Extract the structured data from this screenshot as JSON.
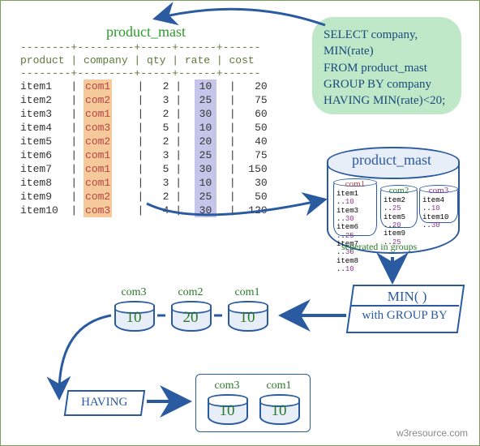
{
  "table_title": "product_mast",
  "headers": {
    "product": "product",
    "company": "company",
    "qty": "qty",
    "rate": "rate",
    "cost": "cost"
  },
  "rows": [
    {
      "product": "item1",
      "company": "com1",
      "qty": "2",
      "rate": "10",
      "cost": "20"
    },
    {
      "product": "item2",
      "company": "com2",
      "qty": "3",
      "rate": "25",
      "cost": "75"
    },
    {
      "product": "item3",
      "company": "com1",
      "qty": "2",
      "rate": "30",
      "cost": "60"
    },
    {
      "product": "item4",
      "company": "com3",
      "qty": "5",
      "rate": "10",
      "cost": "50"
    },
    {
      "product": "item5",
      "company": "com2",
      "qty": "2",
      "rate": "20",
      "cost": "40"
    },
    {
      "product": "item6",
      "company": "com1",
      "qty": "3",
      "rate": "25",
      "cost": "75"
    },
    {
      "product": "item7",
      "company": "com1",
      "qty": "5",
      "rate": "30",
      "cost": "150"
    },
    {
      "product": "item8",
      "company": "com1",
      "qty": "3",
      "rate": "10",
      "cost": "30"
    },
    {
      "product": "item9",
      "company": "com2",
      "qty": "2",
      "rate": "25",
      "cost": "50"
    },
    {
      "product": "item10",
      "company": "com3",
      "qty": "4",
      "rate": "30",
      "cost": "120"
    }
  ],
  "sql": {
    "l1": "SELECT company,",
    "l2": "MIN(rate)",
    "l3": "FROM product_mast",
    "l4": "GROUP BY company",
    "l5": "HAVING MIN(rate)<20;"
  },
  "big_cyl_title": "product_mast",
  "groups": {
    "com1": {
      "name": "com1",
      "items": [
        [
          "item1",
          "10"
        ],
        [
          "item3",
          "30"
        ],
        [
          "item6",
          "25"
        ],
        [
          "item7",
          "30"
        ],
        [
          "item8",
          "10"
        ]
      ]
    },
    "com2": {
      "name": "com2",
      "items": [
        [
          "item2",
          "25"
        ],
        [
          "item5",
          "20"
        ],
        [
          "item9",
          "25"
        ]
      ]
    },
    "com3": {
      "name": "com3",
      "items": [
        [
          "item4",
          "10"
        ],
        [
          "item10",
          "30"
        ]
      ]
    }
  },
  "sep_text": "seperated in groups",
  "min_box": {
    "t1": "MIN( )",
    "t2": "with GROUP BY"
  },
  "mins": {
    "com1": {
      "lbl": "com1",
      "val": "10"
    },
    "com2": {
      "lbl": "com2",
      "val": "20"
    },
    "com3": {
      "lbl": "com3",
      "val": "10"
    }
  },
  "having": "HAVING",
  "final": {
    "com3": {
      "lbl": "com3",
      "val": "10"
    },
    "com1": {
      "lbl": "com1",
      "val": "10"
    }
  },
  "credit": "w3resource.com",
  "chart_data": {
    "type": "table",
    "title": "product_mast",
    "columns": [
      "product",
      "company",
      "qty",
      "rate",
      "cost"
    ],
    "rows": [
      [
        "item1",
        "com1",
        2,
        10,
        20
      ],
      [
        "item2",
        "com2",
        3,
        25,
        75
      ],
      [
        "item3",
        "com1",
        2,
        30,
        60
      ],
      [
        "item4",
        "com3",
        5,
        10,
        50
      ],
      [
        "item5",
        "com2",
        2,
        20,
        40
      ],
      [
        "item6",
        "com1",
        3,
        25,
        75
      ],
      [
        "item7",
        "com1",
        5,
        30,
        150
      ],
      [
        "item8",
        "com1",
        3,
        10,
        30
      ],
      [
        "item9",
        "com2",
        2,
        25,
        50
      ],
      [
        "item10",
        "com3",
        4,
        30,
        120
      ]
    ],
    "query": "SELECT company, MIN(rate) FROM product_mast GROUP BY company HAVING MIN(rate)<20;",
    "group_by_result": [
      {
        "company": "com1",
        "min_rate": 10
      },
      {
        "company": "com2",
        "min_rate": 20
      },
      {
        "company": "com3",
        "min_rate": 10
      }
    ],
    "having_result": [
      {
        "company": "com1",
        "min_rate": 10
      },
      {
        "company": "com3",
        "min_rate": 10
      }
    ]
  }
}
